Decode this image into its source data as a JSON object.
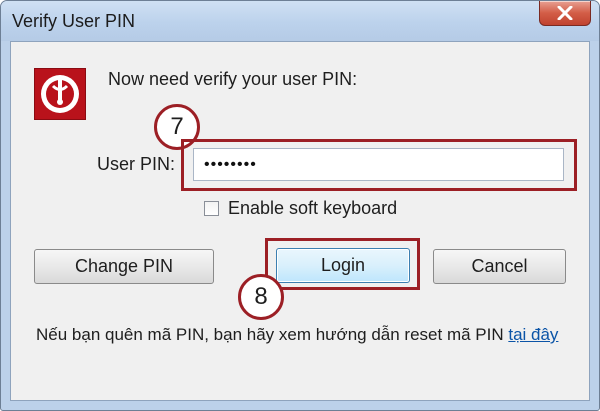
{
  "window": {
    "title": "Verify User PIN"
  },
  "dialog": {
    "prompt": "Now need verify your user PIN:",
    "pin_label": "User PIN:",
    "pin_value": "••••••••",
    "soft_keyboard_label": "Enable soft keyboard",
    "soft_keyboard_checked": false
  },
  "buttons": {
    "change_pin": "Change PIN",
    "login": "Login",
    "cancel": "Cancel"
  },
  "annotations": {
    "step_7": "7",
    "step_8": "8"
  },
  "footer": {
    "text": "Nếu bạn quên mã PIN, bạn hãy xem hướng dẫn reset mã PIN ",
    "link": "tại đây"
  },
  "colors": {
    "annotation_red": "#9c1f25",
    "logo_red": "#b9121b",
    "link_blue": "#0b54a7"
  }
}
